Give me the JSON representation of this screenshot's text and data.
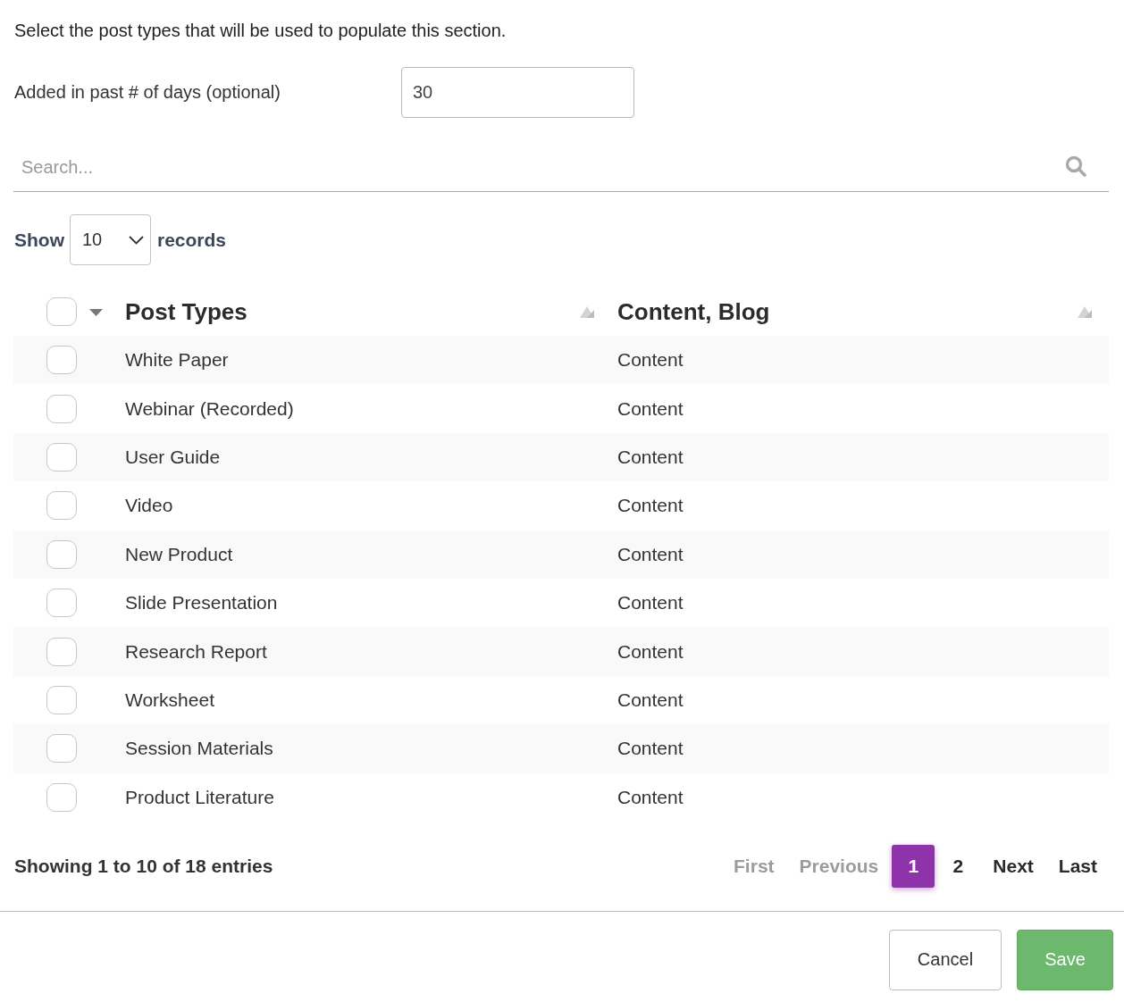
{
  "instruction": "Select the post types that will be used to populate this section.",
  "days_field": {
    "label": "Added in past # of days (optional)",
    "value": "30"
  },
  "search": {
    "placeholder": "Search..."
  },
  "length_menu": {
    "label_before": "Show",
    "value": "10",
    "label_after": "records"
  },
  "table": {
    "select_all": {
      "checked": false
    },
    "columns": [
      {
        "label": "Post Types",
        "sortable": true
      },
      {
        "label": "Content, Blog",
        "sortable": true
      }
    ],
    "rows": [
      {
        "checked": false,
        "cells": [
          "White Paper",
          "Content"
        ]
      },
      {
        "checked": false,
        "cells": [
          "Webinar (Recorded)",
          "Content"
        ]
      },
      {
        "checked": false,
        "cells": [
          "User Guide",
          "Content"
        ]
      },
      {
        "checked": false,
        "cells": [
          "Video",
          "Content"
        ]
      },
      {
        "checked": false,
        "cells": [
          "New Product",
          "Content"
        ]
      },
      {
        "checked": false,
        "cells": [
          "Slide Presentation",
          "Content"
        ]
      },
      {
        "checked": false,
        "cells": [
          "Research Report",
          "Content"
        ]
      },
      {
        "checked": false,
        "cells": [
          "Worksheet",
          "Content"
        ]
      },
      {
        "checked": false,
        "cells": [
          "Session Materials",
          "Content"
        ]
      },
      {
        "checked": false,
        "cells": [
          "Product Literature",
          "Content"
        ]
      }
    ]
  },
  "info": "Showing 1 to 10 of 18 entries",
  "pagination": [
    {
      "label": "First",
      "disabled": true,
      "selected": false
    },
    {
      "label": "Previous",
      "disabled": true,
      "selected": false
    },
    {
      "label": "1",
      "disabled": false,
      "selected": true
    },
    {
      "label": "2",
      "disabled": false,
      "selected": false
    },
    {
      "label": "Next",
      "disabled": false,
      "selected": false
    },
    {
      "label": "Last",
      "disabled": false,
      "selected": false
    }
  ],
  "buttons": [
    {
      "label": "Cancel",
      "kind": "secondary"
    },
    {
      "label": "Save",
      "kind": "primary"
    }
  ]
}
